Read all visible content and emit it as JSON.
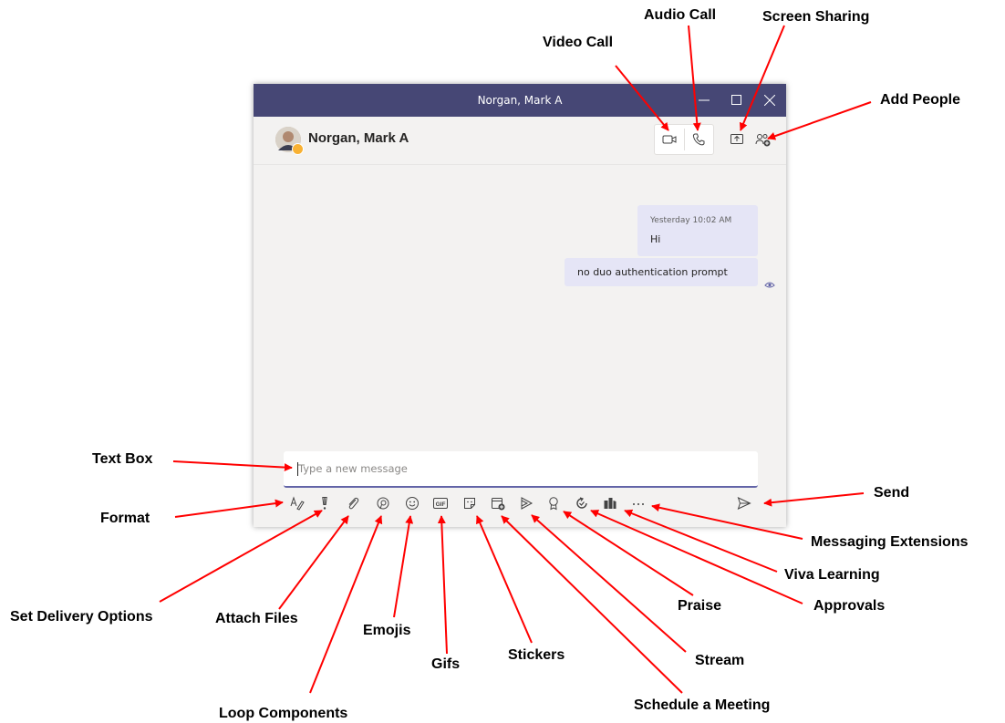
{
  "window": {
    "title": "Norgan, Mark A"
  },
  "header": {
    "contact_name": "Norgan, Mark A"
  },
  "chat": {
    "messages": [
      {
        "timestamp": "Yesterday 10:02 AM",
        "text": "Hi"
      },
      {
        "text": "no duo authentication prompt"
      }
    ]
  },
  "compose": {
    "placeholder": "Type a new message"
  },
  "annotations": {
    "video_call": "Video Call",
    "audio_call": "Audio Call",
    "screen_sharing": "Screen Sharing",
    "add_people": "Add People",
    "text_box": "Text Box",
    "format": "Format",
    "send": "Send",
    "messaging_extensions": "Messaging Extensions",
    "viva_learning": "Viva Learning",
    "approvals": "Approvals",
    "praise": "Praise",
    "stream": "Stream",
    "schedule_meeting": "Schedule a Meeting",
    "stickers": "Stickers",
    "gifs": "Gifs",
    "emojis": "Emojis",
    "loop_components": "Loop Components",
    "attach_files": "Attach Files",
    "set_delivery_options": "Set Delivery Options"
  },
  "colors": {
    "titlebar": "#464775",
    "accent": "#6264a7",
    "bubble": "#e5e5f6",
    "background": "#f3f2f1",
    "annotation_arrow": "#ff0000",
    "status_away": "#f8b133"
  },
  "icons": {
    "titlebar": [
      "minimize-icon",
      "maximize-icon",
      "close-icon"
    ],
    "header": [
      "video-camera-icon",
      "phone-icon",
      "share-screen-icon",
      "add-people-icon"
    ],
    "toolbar": [
      "format-icon",
      "exclamation-icon",
      "paperclip-icon",
      "loop-icon",
      "emoji-icon",
      "gif-icon",
      "sticker-icon",
      "calendar-add-icon",
      "stream-icon",
      "praise-icon",
      "approvals-icon",
      "viva-learning-icon",
      "more-icon",
      "send-icon"
    ],
    "read_receipt": "eye-icon"
  }
}
